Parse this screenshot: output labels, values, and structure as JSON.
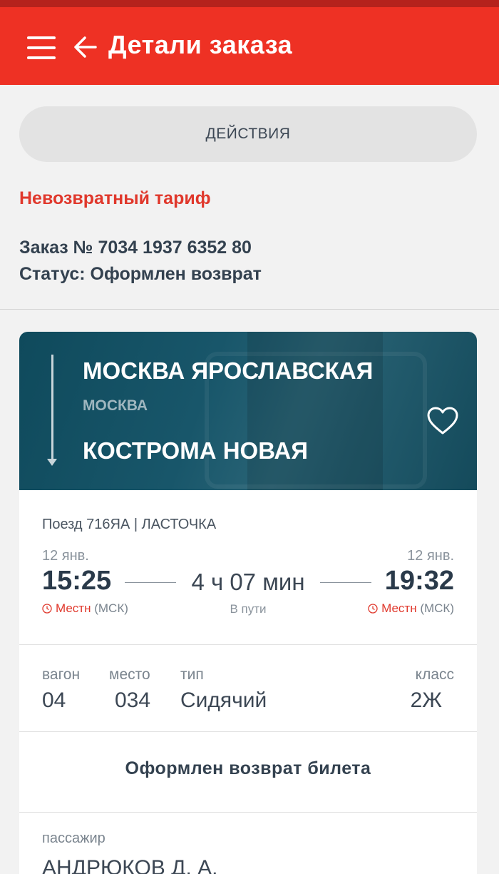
{
  "appbar": {
    "title": "Детали заказа",
    "color": "#ee3124"
  },
  "actions": {
    "label": "ДЕЙСТВИЯ"
  },
  "order": {
    "tariff": "Невозвратный тариф",
    "number": "Заказ № 7034 1937 6352 80",
    "status": "Статус: Оформлен возврат"
  },
  "route": {
    "from_station": "МОСКВА ЯРОСЛАВСКАЯ",
    "from_city": "МОСКВА",
    "to_station": "КОСТРОМА НОВАЯ"
  },
  "trip": {
    "train": "Поезд 716ЯА | ЛАСТОЧКА",
    "departure_date": "12 янв.",
    "departure_time": "15:25",
    "arrival_date": "12 янв.",
    "arrival_time": "19:32",
    "duration": "4 ч 07 мин",
    "duration_label": "В пути",
    "tz_local": "Местн",
    "tz_zone": "(МСК)"
  },
  "seat": {
    "wagon_label": "вагон",
    "wagon_value": "04",
    "seat_label": "место",
    "seat_value": "034",
    "type_label": "тип",
    "type_value": "Сидячий",
    "class_label": "класс",
    "class_value": "2Ж"
  },
  "ticket": {
    "status": "Оформлен возврат билета"
  },
  "passenger": {
    "label": "пассажир",
    "name": "АНДРЮКОВ Д. А."
  }
}
